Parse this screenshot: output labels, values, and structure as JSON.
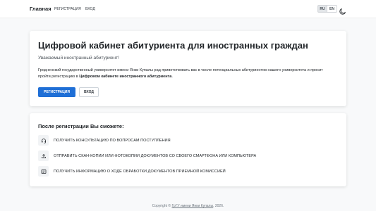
{
  "navbar": {
    "brand": "Главная",
    "links": [
      "РЕГИСТРАЦИЯ",
      "ВХОД"
    ],
    "languages": [
      "RU",
      "EN"
    ],
    "active_language": "RU",
    "theme_icon": "moon-icon"
  },
  "hero": {
    "title": "Цифровой кабинет абитуриента для иностранных граждан",
    "lead": "Уважаемый иностранный абитуриент!",
    "text_before": "Гродненский государственный университет имени Янки Купалы рад приветствовать вас в числе потенциальных абитуриентов нашего университета и просит пройти регистрацию в ",
    "text_bold": "Цифровом кабинете иностранного абитуриента",
    "text_after": ".",
    "register_button": "РЕГИСТРАЦИЯ",
    "login_button": "ВХОД"
  },
  "features": {
    "title": "После регистрации Вы сможете:",
    "items": [
      {
        "icon": "headset-icon",
        "text": "ПОЛУЧИТЬ КОНСУЛЬТАЦИЮ ПО ВОПРОСАМ ПОСТУПЛЕНИЯ"
      },
      {
        "icon": "upload-icon",
        "text": "ОТПРАВИТЬ СКАН-КОПИИ ИЛИ ФОТОКОПИИ ДОКУМЕНТОВ СО СВОЕГО СМАРТФОНА ИЛИ КОМПЬЮТЕРА"
      },
      {
        "icon": "document-icon",
        "text": "ПОЛУЧИТЬ ИНФОРМАЦИЮ О ХОДЕ ОБРАБОТКИ ДОКУМЕНТОВ ПРИЕМНОЙ КОМИССИЕЙ"
      }
    ]
  },
  "footer": {
    "prefix": "Copyright © ",
    "link": "ГрГУ имени Янки Купалы",
    "suffix": ", 2026."
  },
  "colors": {
    "primary": "#1f6fd6",
    "background": "#f8f9fa"
  }
}
